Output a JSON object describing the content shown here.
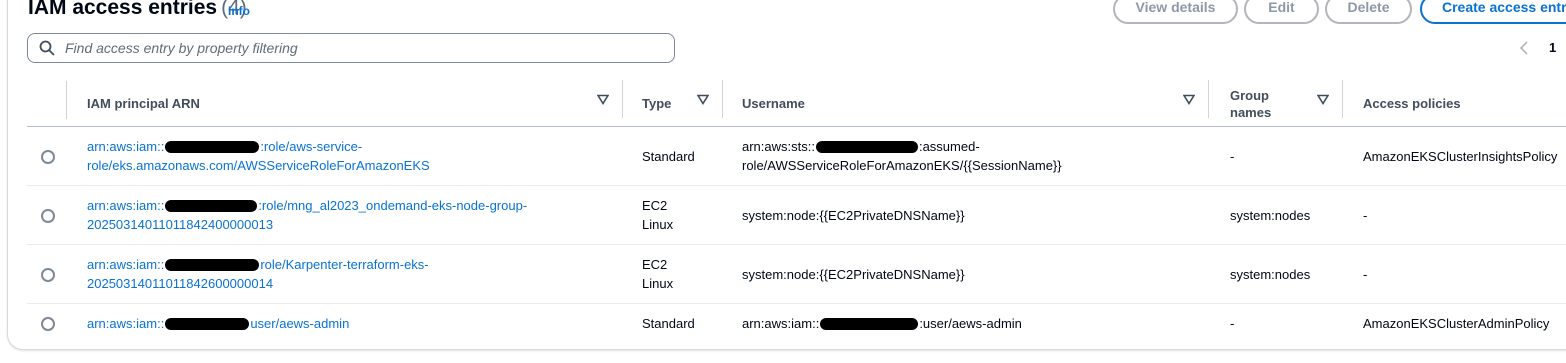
{
  "header": {
    "title": "IAM access entries",
    "count": "(4)",
    "info_label": "Info"
  },
  "actions": {
    "view_details": "View details",
    "edit": "Edit",
    "delete": "Delete",
    "create": "Create access entry"
  },
  "search": {
    "placeholder": "Find access entry by property filtering",
    "value": ""
  },
  "pagination": {
    "current_page": "1"
  },
  "table": {
    "columns": [
      "IAM principal ARN",
      "Type",
      "Username",
      "Group names",
      "Access policies"
    ],
    "group_names_line1": "Group",
    "group_names_line2": "names",
    "rows": [
      {
        "arn_prefix": "arn:aws:iam::",
        "arn_line1_suffix": ":role/aws-service-",
        "arn_line2": "role/eks.amazonaws.com/AWSServiceRoleForAmazonEKS",
        "type_line1": "Standard",
        "type_line2": "",
        "username_prefix": "arn:aws:sts::",
        "username_line1_suffix": ":assumed-",
        "username_line2": "role/AWSServiceRoleForAmazonEKS/{{SessionName}}",
        "group_names": "-",
        "access_policies": "AmazonEKSClusterInsightsPolicy"
      },
      {
        "arn_prefix": "arn:aws:iam::",
        "arn_line1_suffix": ":role/mng_al2023_ondemand-eks-node-group-",
        "arn_line2": "20250314011011842400000013",
        "type_line1": "EC2",
        "type_line2": "Linux",
        "username_prefix": "system:node:{{EC2PrivateDNSName}}",
        "username_line1_suffix": "",
        "username_line2": "",
        "group_names": "system:nodes",
        "access_policies": "-"
      },
      {
        "arn_prefix": "arn:aws:iam::",
        "arn_line1_suffix": "role/Karpenter-terraform-eks-",
        "arn_line2": "20250314011011842600000014",
        "type_line1": "EC2",
        "type_line2": "Linux",
        "username_prefix": "system:node:{{EC2PrivateDNSName}}",
        "username_line1_suffix": "",
        "username_line2": "",
        "group_names": "system:nodes",
        "access_policies": "-"
      },
      {
        "arn_prefix": "arn:aws:iam::",
        "arn_line1_suffix": "user/aews-admin",
        "arn_line2": "",
        "type_line1": "Standard",
        "type_line2": "",
        "username_prefix": "arn:aws:iam::",
        "username_line1_suffix": ":user/aews-admin",
        "username_line2": "",
        "group_names": "-",
        "access_policies": "AmazonEKSClusterAdminPolicy"
      }
    ]
  },
  "colors": {
    "link": "#0972d3",
    "header_text": "#414d5c",
    "disabled_button": "#8d99a8",
    "redaction": "#000000"
  },
  "icons": [
    "search-icon",
    "sort-caret-icon",
    "chevron-left-icon",
    "radio-icon"
  ]
}
